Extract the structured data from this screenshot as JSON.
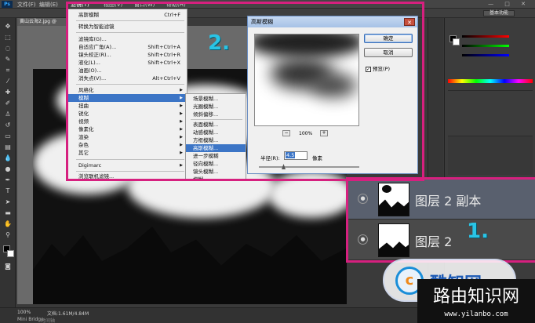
{
  "menubar": {
    "logo": "Ps",
    "items": [
      "文件(F)",
      "编辑(E)",
      "滤镜(T)",
      "视图(V)",
      "窗口(W)",
      "帮助(H)"
    ],
    "window_controls": "— □ ✕"
  },
  "optbar": {
    "workspace": "基本功能"
  },
  "document": {
    "tab_title": "黄山云海2.jpg @ 100%"
  },
  "filter_menu": {
    "items": [
      {
        "label": "高斯模糊",
        "shortcut": "Ctrl+F"
      },
      {
        "label": "转换为智能滤镜",
        "shortcut": ""
      },
      {
        "label": "滤镜库(G)...",
        "shortcut": ""
      },
      {
        "label": "自适应广角(A)...",
        "shortcut": "Shift+Ctrl+A"
      },
      {
        "label": "镜头校正(R)...",
        "shortcut": "Shift+Ctrl+R"
      },
      {
        "label": "液化(L)...",
        "shortcut": "Shift+Ctrl+X"
      },
      {
        "label": "油画(O)...",
        "shortcut": ""
      },
      {
        "label": "消失点(V)...",
        "shortcut": "Alt+Ctrl+V"
      },
      {
        "label": "风格化",
        "shortcut": ""
      },
      {
        "label": "模糊",
        "shortcut": ""
      },
      {
        "label": "扭曲",
        "shortcut": ""
      },
      {
        "label": "锐化",
        "shortcut": ""
      },
      {
        "label": "视频",
        "shortcut": ""
      },
      {
        "label": "像素化",
        "shortcut": ""
      },
      {
        "label": "渲染",
        "shortcut": ""
      },
      {
        "label": "杂色",
        "shortcut": ""
      },
      {
        "label": "其它",
        "shortcut": ""
      },
      {
        "label": "Digimarc",
        "shortcut": ""
      },
      {
        "label": "浏览联机滤镜...",
        "shortcut": ""
      }
    ]
  },
  "blur_submenu": {
    "items": [
      "场景模糊...",
      "光圈模糊...",
      "倾斜偏移...",
      "表面模糊...",
      "动感模糊...",
      "方框模糊...",
      "高斯模糊...",
      "进一步模糊",
      "径向模糊...",
      "镜头模糊...",
      "模糊"
    ]
  },
  "gaussian_dialog": {
    "title": "高斯模糊",
    "ok": "确定",
    "cancel": "取消",
    "preview_label": "预览(P)",
    "preview_checked": true,
    "zoom": "100%",
    "zoom_out": "−",
    "zoom_in": "+",
    "radius_label": "半径(R):",
    "radius_value": "4.5",
    "radius_unit": "像素",
    "close": "✕"
  },
  "annotations": {
    "step1": "1.",
    "step2": "2."
  },
  "layers": [
    {
      "name": "图层 2 副本",
      "selected": true
    },
    {
      "name": "图层 2",
      "selected": false
    }
  ],
  "status": {
    "zoom": "100%",
    "docsize": "文档:1.61M/4.84M",
    "tab_minibridge": "Mini Bridge",
    "tab_timeline": "时间轴"
  },
  "watermarks": {
    "badge_logo": "c",
    "badge_text": "酷知网",
    "corner_title": "路由知识网",
    "corner_url": "www.yilanbo.com"
  },
  "colors": {
    "highlight": "#d6207f",
    "step_number": "#29c4e6",
    "menu_highlight": "#3c75c6"
  }
}
